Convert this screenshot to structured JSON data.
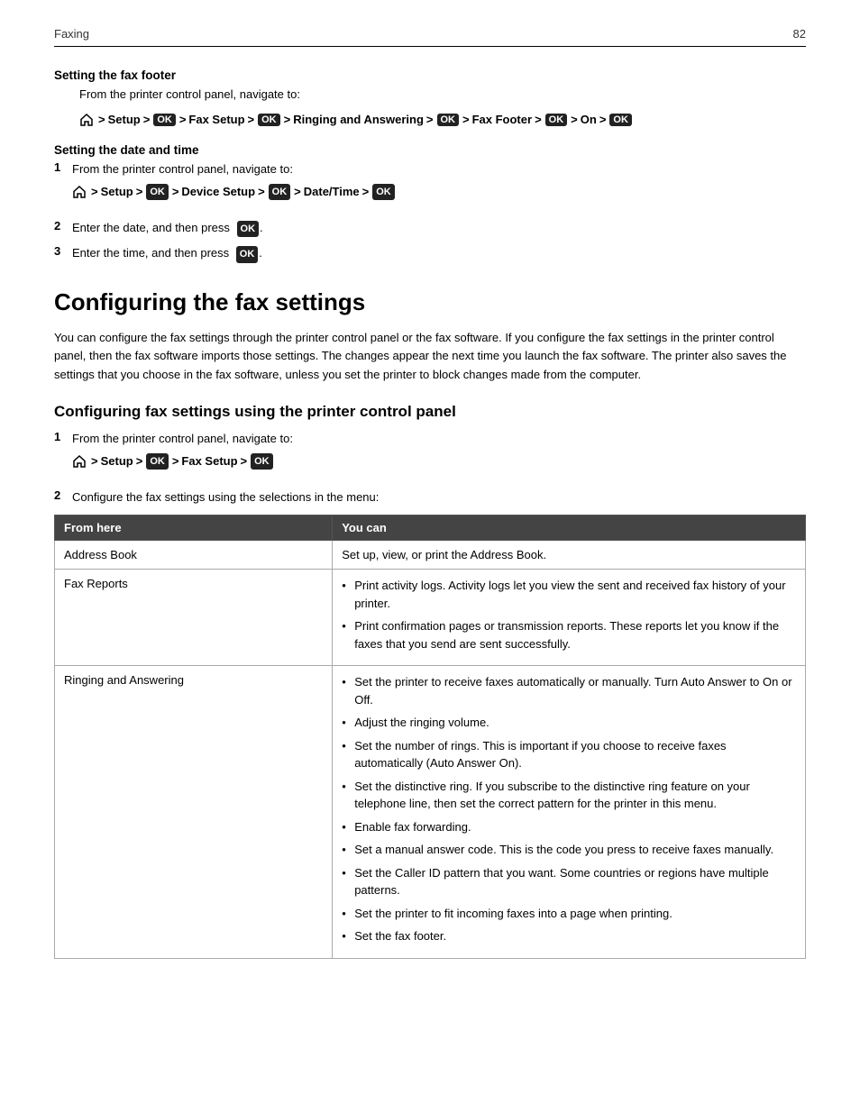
{
  "header": {
    "title": "Faxing",
    "page_number": "82"
  },
  "section_fax_footer": {
    "heading": "Setting the fax footer",
    "step_text": "From the printer control panel, navigate to:",
    "nav_parts": [
      "Setup",
      "OK",
      "Fax Setup",
      "OK",
      "Ringing and Answering",
      "OK",
      "Fax Footer",
      "OK",
      "On",
      "OK"
    ]
  },
  "section_date_time": {
    "heading": "Setting the date and time",
    "steps": [
      {
        "num": "1",
        "text": "From the printer control panel, navigate to:",
        "nav_parts": [
          "Setup",
          "OK",
          "Device Setup",
          "OK",
          "Date/Time",
          "OK"
        ]
      },
      {
        "num": "2",
        "text": "Enter the date, and then press",
        "has_ok": true
      },
      {
        "num": "3",
        "text": "Enter the time, and then press",
        "has_ok": true
      }
    ]
  },
  "main_heading": "Configuring the fax settings",
  "intro_paragraph": "You can configure the fax settings through the printer control panel or the fax software. If you configure the fax settings in the printer control panel, then the fax software imports those settings. The changes appear the next time you launch the fax software. The printer also saves the settings that you choose in the fax software, unless you set the printer to block changes made from the computer.",
  "sub_heading": "Configuring fax settings using the printer control panel",
  "panel_steps": [
    {
      "num": "1",
      "text": "From the printer control panel, navigate to:",
      "nav_parts": [
        "Setup",
        "OK",
        "Fax Setup",
        "OK"
      ]
    },
    {
      "num": "2",
      "text": "Configure the fax settings using the selections in the menu:"
    }
  ],
  "table": {
    "headers": [
      "From here",
      "You can"
    ],
    "rows": [
      {
        "from": "Address Book",
        "you_can": [
          "Set up, view, or print the Address Book."
        ],
        "bullets": false
      },
      {
        "from": "Fax Reports",
        "you_can": [
          "Print activity logs. Activity logs let you view the sent and received fax history of your printer.",
          "Print confirmation pages or transmission reports. These reports let you know if the faxes that you send are sent successfully."
        ],
        "bullets": true
      },
      {
        "from": "Ringing and Answering",
        "you_can": [
          "Set the printer to receive faxes automatically or manually. Turn Auto Answer to On or Off.",
          "Adjust the ringing volume.",
          "Set the number of rings. This is important if you choose to receive faxes automatically (Auto Answer On).",
          "Set the distinctive ring. If you subscribe to the distinctive ring feature on your telephone line, then set the correct pattern for the printer in this menu.",
          "Enable fax forwarding.",
          "Set a manual answer code. This is the code you press to receive faxes manually.",
          "Set the Caller ID pattern that you want. Some countries or regions have multiple patterns.",
          "Set the printer to fit incoming faxes into a page when printing.",
          "Set the fax footer."
        ],
        "bullets": true
      }
    ]
  }
}
